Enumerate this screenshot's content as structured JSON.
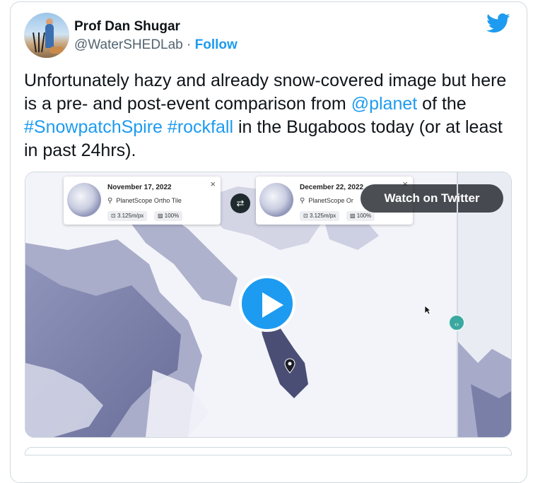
{
  "author": {
    "name": "Prof Dan Shugar",
    "handle": "@WaterSHEDLab",
    "separator": " · ",
    "follow_label": "Follow"
  },
  "tweet": {
    "part1": "Unfortunately hazy and already snow-covered image but here is a pre- and post-event comparison from ",
    "mention": "@planet",
    "part2": " of the ",
    "hashtag1": "#SnowpatchSpire",
    "space": " ",
    "hashtag2": "#rockfall",
    "part3": " in the Bugaboos today (or at least in past 24hrs)."
  },
  "media": {
    "watch_label": "Watch on Twitter",
    "left_card": {
      "date": "November 17, 2022",
      "product": "PlanetScope Ortho Tile",
      "resolution": "3.125m/px",
      "coverage": "100%",
      "close": "×"
    },
    "right_card": {
      "date": "December 22, 2022",
      "product": "PlanetScope Or",
      "resolution": "3.125m/px",
      "coverage": "100%",
      "close": "×"
    },
    "swap_icon": "⇄",
    "slider_icon": "‹›"
  },
  "icons": [
    "twitter-bird-icon",
    "play-icon",
    "swap-icon",
    "slider-handle-icon",
    "map-pin-icon",
    "cursor-icon",
    "satellite-icon",
    "resolution-icon",
    "coverage-icon"
  ],
  "colors": {
    "accent": "#1d9bf0",
    "text": "#0f1419",
    "muted": "#536471"
  }
}
